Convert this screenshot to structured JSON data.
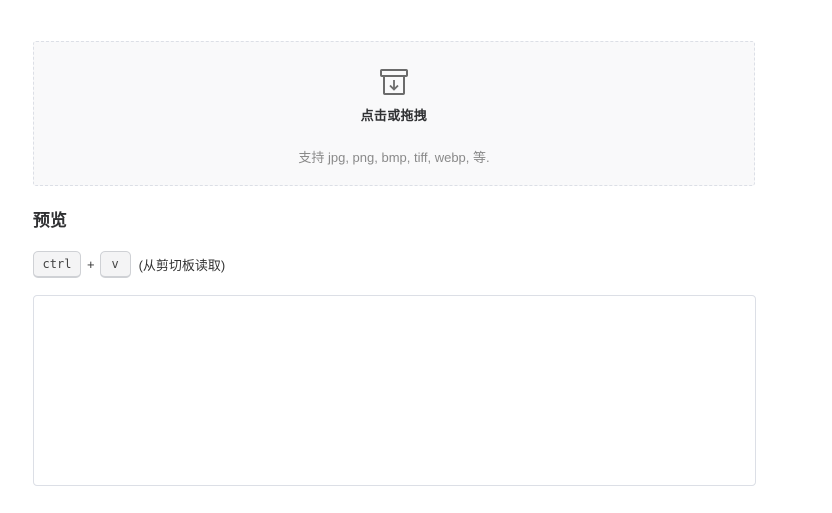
{
  "upload": {
    "icon": "download-box-icon",
    "title": "点击或拖拽",
    "hint": "支持 jpg, png, bmp, tiff, webp, 等."
  },
  "preview": {
    "heading": "预览",
    "shortcut": {
      "key1": "ctrl",
      "plus": "+",
      "key2": "v",
      "note": "(从剪切板读取)"
    },
    "box_content": ""
  },
  "colors": {
    "dropzone_bg": "#f9f9fa",
    "border": "#dcdfe6",
    "text_primary": "#303133",
    "text_secondary": "#8a8a8a"
  }
}
